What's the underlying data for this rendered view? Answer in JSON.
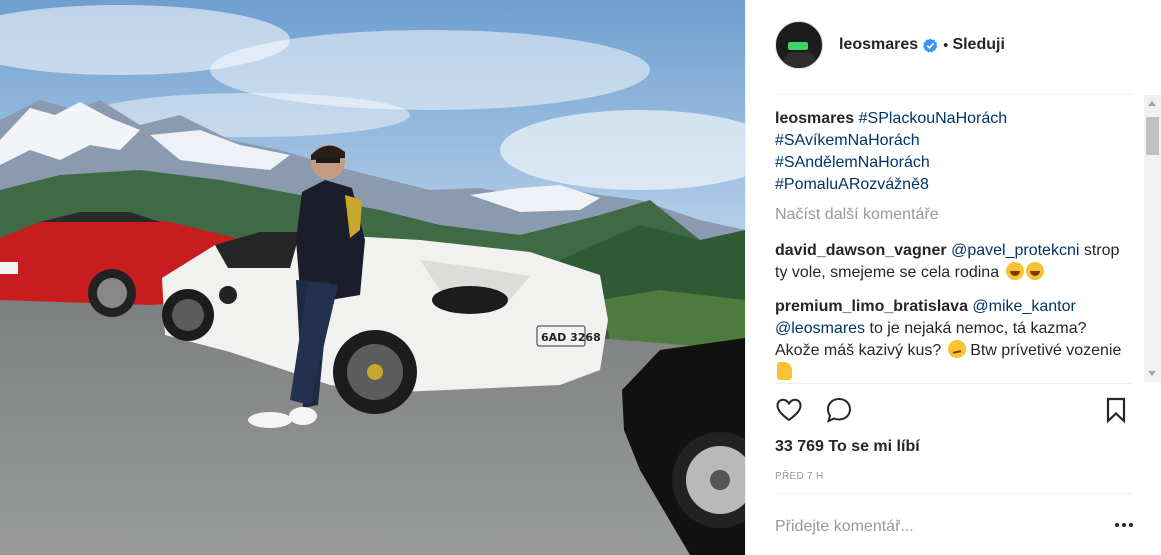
{
  "post": {
    "image_alt": "Muž opřený o bílé Ferrari na horské silnici",
    "author": "leosmares",
    "verified": true,
    "separator": "•",
    "follow_label": "Sleduji"
  },
  "caption": {
    "username": "leosmares",
    "hashtags": [
      "#SPlackouNaHorách",
      "#SAvíkemNaHorách",
      "#SAndělemNaHorách",
      "#PomaluARozvážně8"
    ]
  },
  "load_more_label": "Načíst další komentáře",
  "comments": [
    {
      "username": "david_dawson_vagner",
      "mention": "@pavel_protekcni",
      "text": "strop ty vole, smejeme se cela rodina"
    },
    {
      "username": "premium_limo_bratislava",
      "mention": "@mike_kantor",
      "mention2": "@leosmares",
      "text": "to je nejaká nemoc, tá kazma? Akože máš kazivý kus?",
      "text2": "Btw prívetivé vozenie"
    }
  ],
  "likes": "33 769 To se mi líbí",
  "timestamp": "PŘED 7 H",
  "comment_input": {
    "placeholder": "Přidejte komentář..."
  },
  "icons": [
    "heart-icon",
    "comment-icon",
    "bookmark-icon",
    "verified-icon",
    "more-options-icon"
  ],
  "colors": {
    "link": "#003569",
    "text": "#262626",
    "muted": "#999999",
    "verified": "#3897f0"
  }
}
